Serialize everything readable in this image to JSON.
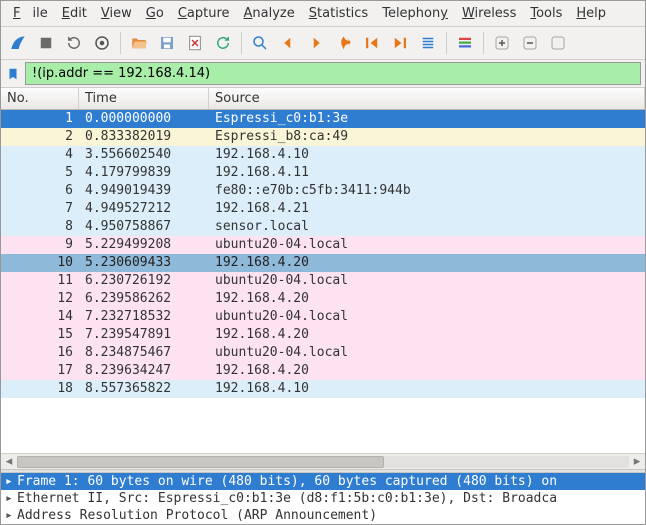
{
  "menu": {
    "file": "File",
    "edit": "Edit",
    "view": "View",
    "go": "Go",
    "capture": "Capture",
    "analyze": "Analyze",
    "statistics": "Statistics",
    "telephony": "Telephony",
    "wireless": "Wireless",
    "tools": "Tools",
    "help": "Help"
  },
  "filter": {
    "value": "!(ip.addr == 192.168.4.14)"
  },
  "columns": {
    "no": "No.",
    "time": "Time",
    "source": "Source"
  },
  "packets": [
    {
      "no": "1",
      "time": "0.000000000",
      "source": "Espressi_c0:b1:3e",
      "style": "selected-primary"
    },
    {
      "no": "2",
      "time": "0.833382019",
      "source": "Espressi_b8:ca:49",
      "style": "cream"
    },
    {
      "no": "4",
      "time": "3.556602540",
      "source": "192.168.4.10",
      "style": "blue"
    },
    {
      "no": "5",
      "time": "4.179799839",
      "source": "192.168.4.11",
      "style": "blue"
    },
    {
      "no": "6",
      "time": "4.949019439",
      "source": "fe80::e70b:c5fb:3411:944b",
      "style": "blue"
    },
    {
      "no": "7",
      "time": "4.949527212",
      "source": "192.168.4.21",
      "style": "blue"
    },
    {
      "no": "8",
      "time": "4.950758867",
      "source": "sensor.local",
      "style": "blue"
    },
    {
      "no": "9",
      "time": "5.229499208",
      "source": "ubuntu20-04.local",
      "style": "pink"
    },
    {
      "no": "10",
      "time": "5.230609433",
      "source": "192.168.4.20",
      "style": "selected-secondary"
    },
    {
      "no": "11",
      "time": "6.230726192",
      "source": "ubuntu20-04.local",
      "style": "pink"
    },
    {
      "no": "12",
      "time": "6.239586262",
      "source": "192.168.4.20",
      "style": "pink"
    },
    {
      "no": "14",
      "time": "7.232718532",
      "source": "ubuntu20-04.local",
      "style": "pink"
    },
    {
      "no": "15",
      "time": "7.239547891",
      "source": "192.168.4.20",
      "style": "pink"
    },
    {
      "no": "16",
      "time": "8.234875467",
      "source": "ubuntu20-04.local",
      "style": "pink"
    },
    {
      "no": "17",
      "time": "8.239634247",
      "source": "192.168.4.20",
      "style": "pink"
    },
    {
      "no": "18",
      "time": "8.557365822",
      "source": "192.168.4.10",
      "style": "blue"
    }
  ],
  "details": {
    "line1": "Frame 1: 60 bytes on wire (480 bits), 60 bytes captured (480 bits) on",
    "line2": "Ethernet II, Src: Espressi_c0:b1:3e (d8:f1:5b:c0:b1:3e), Dst: Broadca",
    "line3": "Address Resolution Protocol (ARP Announcement)"
  },
  "icons": {
    "fin": "shark-fin-icon",
    "stop": "stop-icon",
    "restart": "restart-icon",
    "options": "options-icon",
    "open": "open-folder-icon",
    "save": "save-icon",
    "close": "close-file-icon",
    "reload": "reload-icon",
    "find": "find-icon",
    "prev": "prev-icon",
    "next": "next-icon",
    "jump": "jump-icon",
    "first": "goto-first-icon",
    "last": "goto-last-icon",
    "autoscroll": "autoscroll-icon",
    "colorize": "colorize-icon",
    "zoomin": "zoom-in-icon",
    "zoomout": "zoom-out-icon"
  }
}
